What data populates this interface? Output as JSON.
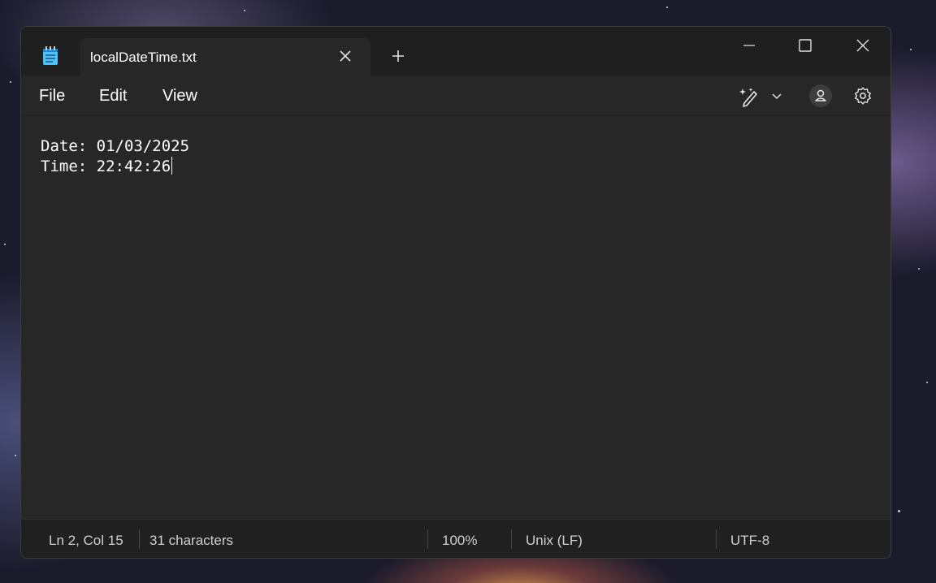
{
  "tab": {
    "title": "localDateTime.txt"
  },
  "menu": {
    "file": "File",
    "edit": "Edit",
    "view": "View"
  },
  "editor": {
    "lines": [
      "Date: 01/03/2025",
      "Time: 22:42:26"
    ]
  },
  "status": {
    "position": "Ln 2, Col 15",
    "characters": "31 characters",
    "zoom": "100%",
    "line_ending": "Unix (LF)",
    "encoding": "UTF-8"
  },
  "icons": {
    "app": "notepad-icon",
    "close_tab": "close-icon",
    "new_tab": "plus-icon",
    "minimize": "minimize-icon",
    "maximize": "maximize-icon",
    "close_window": "close-icon",
    "copilot": "copilot-pen-icon",
    "dropdown": "chevron-down-icon",
    "account": "account-icon",
    "settings": "gear-icon"
  },
  "colors": {
    "window_bg": "#272727",
    "titlebar_bg": "#1f1f1f",
    "statusbar_bg": "#202020",
    "text": "#ffffff",
    "accent": "#4cc2ff"
  }
}
